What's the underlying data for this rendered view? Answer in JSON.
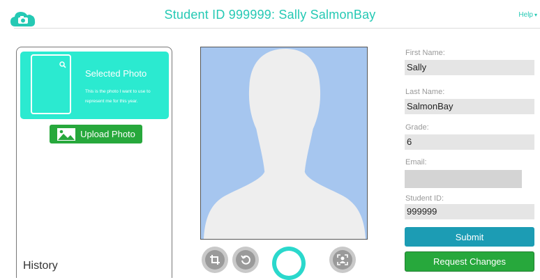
{
  "header": {
    "title": "Student ID 999999: Sally SalmonBay",
    "help_label": "Help",
    "accent_color": "#25c9b4"
  },
  "left_panel": {
    "selected_title": "Selected Photo",
    "selected_description": "This is the photo I want to use to represent me for this year.",
    "upload_label": "Upload Photo",
    "history_label": "History"
  },
  "toolbar": {
    "icons": [
      "crop-icon",
      "rotate-icon",
      "capture-icon",
      "portrait-icon"
    ]
  },
  "form": {
    "first_name_label": "First Name:",
    "first_name_value": "Sally",
    "last_name_label": "Last Name:",
    "last_name_value": "SalmonBay",
    "grade_label": "Grade:",
    "grade_value": "6",
    "email_label": "Email:",
    "email_value": "",
    "student_id_label": "Student ID:",
    "student_id_value": "999999",
    "submit_label": "Submit",
    "request_label": "Request Changes"
  },
  "colors": {
    "submit": "#1c9cb4",
    "request": "#27a83c",
    "selected_card": "#2bead0",
    "silhouette_bg": "#a6c6ef"
  }
}
